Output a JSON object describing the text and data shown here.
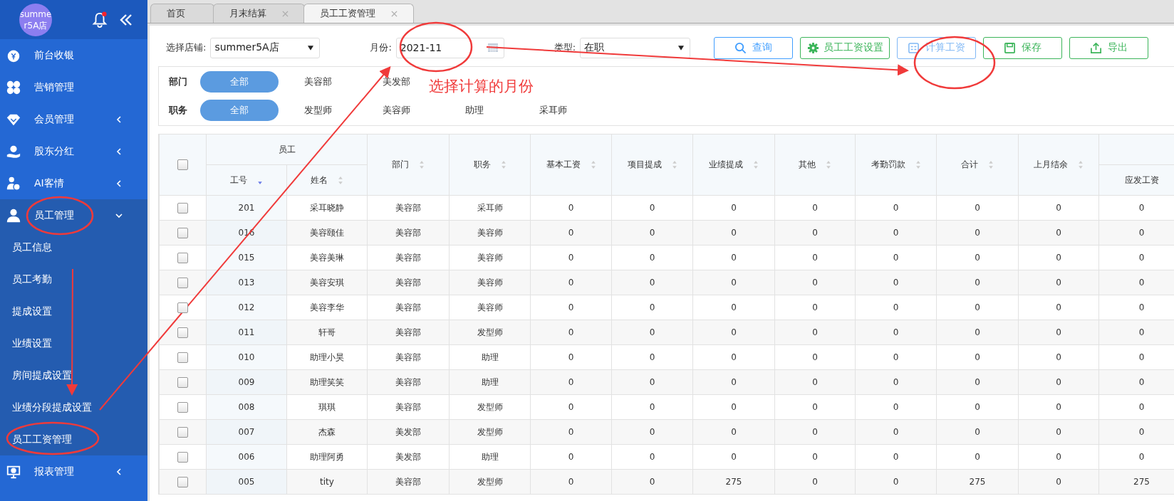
{
  "sidebar": {
    "store_avatar": "summer5A店",
    "items": [
      {
        "label": "前台收银",
        "kind": "link",
        "expanded": false
      },
      {
        "label": "营销管理",
        "kind": "link",
        "expanded": false
      },
      {
        "label": "会员管理",
        "kind": "group",
        "expanded": false
      },
      {
        "label": "股东分红",
        "kind": "group",
        "expanded": false
      },
      {
        "label": "AI客情",
        "kind": "group",
        "expanded": false
      },
      {
        "label": "员工管理",
        "kind": "group",
        "expanded": true,
        "children": [
          {
            "label": "员工信息"
          },
          {
            "label": "员工考勤"
          },
          {
            "label": "提成设置"
          },
          {
            "label": "业绩设置"
          },
          {
            "label": "房间提成设置"
          },
          {
            "label": "业绩分段提成设置"
          },
          {
            "label": "员工工资管理"
          }
        ]
      },
      {
        "label": "报表管理",
        "kind": "group",
        "expanded": false
      }
    ]
  },
  "tabs": [
    {
      "label": "首页",
      "selected": false,
      "closable": false
    },
    {
      "label": "月末结算",
      "selected": false,
      "closable": true
    },
    {
      "label": "员工工资管理",
      "selected": true,
      "closable": true
    }
  ],
  "toolbar": {
    "store_label": "选择店铺:",
    "store_value": "summer5A店",
    "month_label": "月份:",
    "month_value": "2021-11",
    "type_label": "类型:",
    "type_value": "在职",
    "buttons": [
      {
        "label": "查询",
        "color": "#409eff"
      },
      {
        "label": "员工工资设置",
        "color": "#3cb55a"
      },
      {
        "label": "计算工资",
        "color": "#80b8f5"
      },
      {
        "label": "保存",
        "color": "#3cb55a"
      },
      {
        "label": "导出",
        "color": "#3cb55a"
      }
    ]
  },
  "filters": [
    {
      "label": "部门",
      "options": [
        {
          "label": "全部",
          "selected": true
        },
        {
          "label": "美容部",
          "selected": false
        },
        {
          "label": "美发部",
          "selected": false
        }
      ]
    },
    {
      "label": "职务",
      "options": [
        {
          "label": "全部",
          "selected": true
        },
        {
          "label": "发型师",
          "selected": false
        },
        {
          "label": "美容师",
          "selected": false
        },
        {
          "label": "助理",
          "selected": false
        },
        {
          "label": "采耳师",
          "selected": false
        }
      ]
    }
  ],
  "table": {
    "header_checked": false,
    "group": "员工",
    "columns": [
      {
        "label": "工号",
        "sorted": true
      },
      {
        "label": "姓名",
        "sorted": false
      },
      {
        "label": "部门",
        "sorted": false
      },
      {
        "label": "职务",
        "sorted": false
      },
      {
        "label": "基本工资",
        "sorted": false
      },
      {
        "label": "项目提成",
        "sorted": false
      },
      {
        "label": "业绩提成",
        "sorted": false
      },
      {
        "label": "其他",
        "sorted": false
      },
      {
        "label": "考勤罚款",
        "sorted": false
      },
      {
        "label": "合计",
        "sorted": false
      },
      {
        "label": "上月结余",
        "sorted": false
      },
      {
        "label": "应发工资"
      }
    ],
    "rows": [
      {
        "checked": false,
        "cells": [
          "201",
          "采耳晓静",
          "美容部",
          "采耳师",
          "0",
          "0",
          "0",
          "0",
          "0",
          "0",
          "0",
          "0"
        ]
      },
      {
        "checked": false,
        "cells": [
          "016",
          "美容颐佳",
          "美容部",
          "美容师",
          "0",
          "0",
          "0",
          "0",
          "0",
          "0",
          "0",
          "0"
        ]
      },
      {
        "checked": false,
        "cells": [
          "015",
          "美容美琳",
          "美容部",
          "美容师",
          "0",
          "0",
          "0",
          "0",
          "0",
          "0",
          "0",
          "0"
        ]
      },
      {
        "checked": false,
        "cells": [
          "013",
          "美容安琪",
          "美容部",
          "美容师",
          "0",
          "0",
          "0",
          "0",
          "0",
          "0",
          "0",
          "0"
        ]
      },
      {
        "checked": false,
        "cells": [
          "012",
          "美容李华",
          "美容部",
          "美容师",
          "0",
          "0",
          "0",
          "0",
          "0",
          "0",
          "0",
          "0"
        ]
      },
      {
        "checked": false,
        "cells": [
          "011",
          "轩哥",
          "美容部",
          "发型师",
          "0",
          "0",
          "0",
          "0",
          "0",
          "0",
          "0",
          "0"
        ]
      },
      {
        "checked": false,
        "cells": [
          "010",
          "助理小昊",
          "美容部",
          "助理",
          "0",
          "0",
          "0",
          "0",
          "0",
          "0",
          "0",
          "0"
        ]
      },
      {
        "checked": false,
        "cells": [
          "009",
          "助理笑笑",
          "美容部",
          "助理",
          "0",
          "0",
          "0",
          "0",
          "0",
          "0",
          "0",
          "0"
        ]
      },
      {
        "checked": false,
        "cells": [
          "008",
          "琪琪",
          "美容部",
          "发型师",
          "0",
          "0",
          "0",
          "0",
          "0",
          "0",
          "0",
          "0"
        ]
      },
      {
        "checked": false,
        "cells": [
          "007",
          "杰森",
          "美发部",
          "发型师",
          "0",
          "0",
          "0",
          "0",
          "0",
          "0",
          "0",
          "0"
        ]
      },
      {
        "checked": false,
        "cells": [
          "006",
          "助理阿勇",
          "美发部",
          "助理",
          "0",
          "0",
          "0",
          "0",
          "0",
          "0",
          "0",
          "0"
        ]
      },
      {
        "checked": false,
        "cells": [
          "005",
          "tity",
          "美容部",
          "发型师",
          "0",
          "0",
          "275",
          "0",
          "0",
          "275",
          "0",
          "275"
        ]
      }
    ]
  },
  "annotation": {
    "note": "选择计算的月份"
  }
}
